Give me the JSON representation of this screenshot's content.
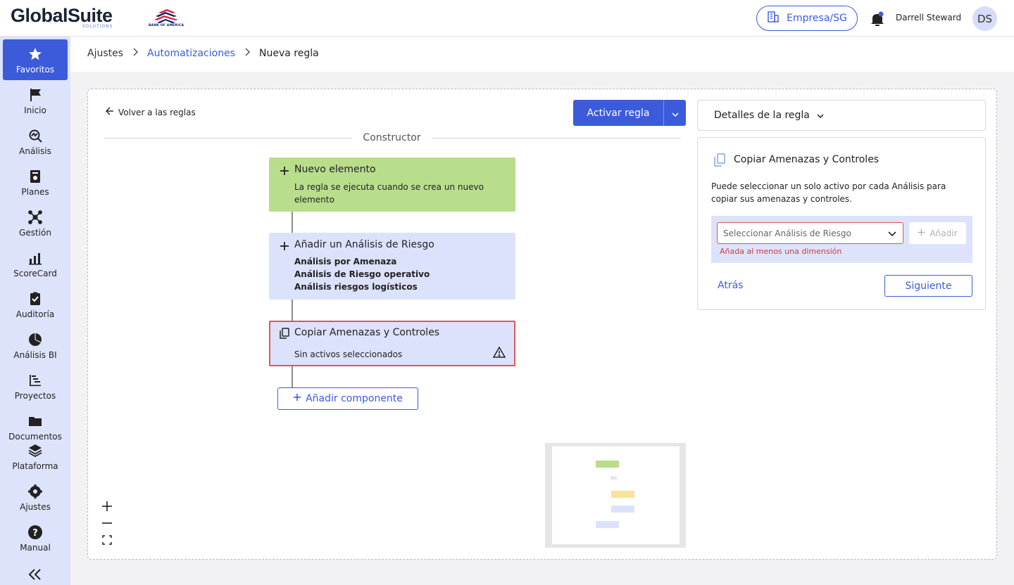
{
  "brand": {
    "name": "GlobalSuite",
    "sub": "SOLUTIONS",
    "partner": "BANK OF AMERICA"
  },
  "header": {
    "company": "Empresa/SG",
    "user_name": "Darrell Steward",
    "avatar_initials": "DS"
  },
  "sidebar": {
    "items": [
      {
        "label": "Favoritos",
        "icon": "star-icon",
        "active": true
      },
      {
        "label": "Inicio",
        "icon": "flag-icon"
      },
      {
        "label": "Análisis",
        "icon": "analysis-icon"
      },
      {
        "label": "Planes",
        "icon": "plans-icon"
      },
      {
        "label": "Gestión",
        "icon": "network-icon"
      },
      {
        "label": "ScoreCard",
        "icon": "chart-icon"
      },
      {
        "label": "Auditoría",
        "icon": "clipboard-check-icon"
      },
      {
        "label": "Análisis BI",
        "icon": "pie-icon"
      },
      {
        "label": "Proyectos",
        "icon": "gantt-icon"
      },
      {
        "label": "Documentos",
        "icon": "folder-icon"
      },
      {
        "label": "Plataforma",
        "icon": "layers-icon"
      },
      {
        "label": "Ajustes",
        "icon": "gear-icon"
      },
      {
        "label": "Manual",
        "icon": "help-icon"
      }
    ]
  },
  "breadcrumb": {
    "root": "Ajustes",
    "section": "Automatizaciones",
    "current": "Nueva regla"
  },
  "builder": {
    "back_label": "Volver a las reglas",
    "activate_label": "Activar regla",
    "divider_label": "Constructor",
    "trigger": {
      "title": "Nuevo elemento",
      "desc": "La regla se ejecuta cuando se crea un nuevo elemento"
    },
    "action1": {
      "title": "Añadir un Análisis de Riesgo",
      "items": [
        "Análisis por Amenaza",
        "Análisis de Riesgo operativo",
        "Análisis riesgos logísticos"
      ]
    },
    "action2": {
      "title": "Copiar Amenazas y Controles",
      "desc": "Sin activos seleccionados"
    },
    "add_component_label": "Añadir componente"
  },
  "panel": {
    "header": "Detalles de la regla",
    "title": "Copiar Amenazas y Controles",
    "desc": "Puede seleccionar un solo activo por cada Análisis para copiar sus amenazas y controles.",
    "select_placeholder": "Seleccionar Análisis de Riesgo",
    "add_label": "Añadir",
    "error": "Añada al menos una dimensión",
    "back_label": "Atrás",
    "next_label": "Siguiente"
  },
  "colors": {
    "accent": "#3b5bdb",
    "trigger": "#b8de8c",
    "action": "#dce2fb",
    "error": "#e05555",
    "sidebar": "#dde3fb"
  }
}
